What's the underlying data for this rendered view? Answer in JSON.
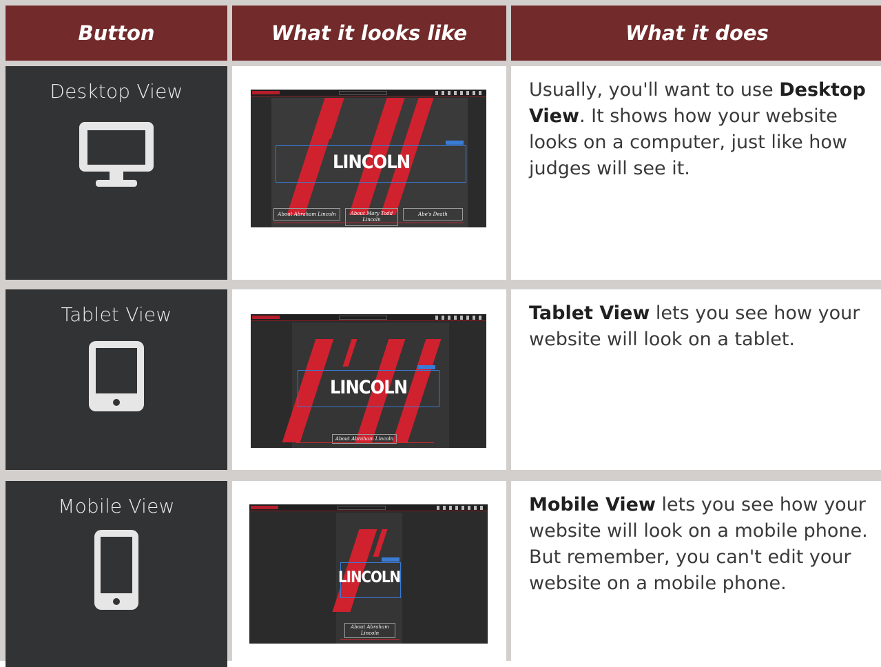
{
  "header": {
    "col1": "Button",
    "col2": "What it looks like",
    "col3": "What it does"
  },
  "colors": {
    "header_bg": "#722a2b",
    "button_bg": "#323334",
    "accent_red": "#d0212f"
  },
  "rows": [
    {
      "button_label": "Desktop View",
      "icon": "desktop-monitor-icon",
      "preview_word": "LINCOLN",
      "preview_nav": [
        "About Abraham Lincoln",
        "About Mary Todd Lincoln",
        "Abe's Death"
      ],
      "desc": {
        "pre": "Usually, you'll want to use ",
        "bold": "Desktop View",
        "post": ". It shows how your website looks on a computer, just like how judges will see it."
      }
    },
    {
      "button_label": "Tablet View",
      "icon": "tablet-icon",
      "preview_word": "LINCOLN",
      "preview_nav": [
        "About Abraham Lincoln"
      ],
      "desc": {
        "bold": "Tablet View",
        "post": " lets you see how your website will look on a tablet."
      }
    },
    {
      "button_label": "Mobile View",
      "icon": "mobile-phone-icon",
      "preview_word": "LINCOLN",
      "preview_nav": [
        "About Abraham Lincoln"
      ],
      "desc": {
        "bold": "Mobile View",
        "post": " lets you see how your website will look on a mobile phone. But remember, you can't edit your website on a mobile phone."
      }
    }
  ]
}
